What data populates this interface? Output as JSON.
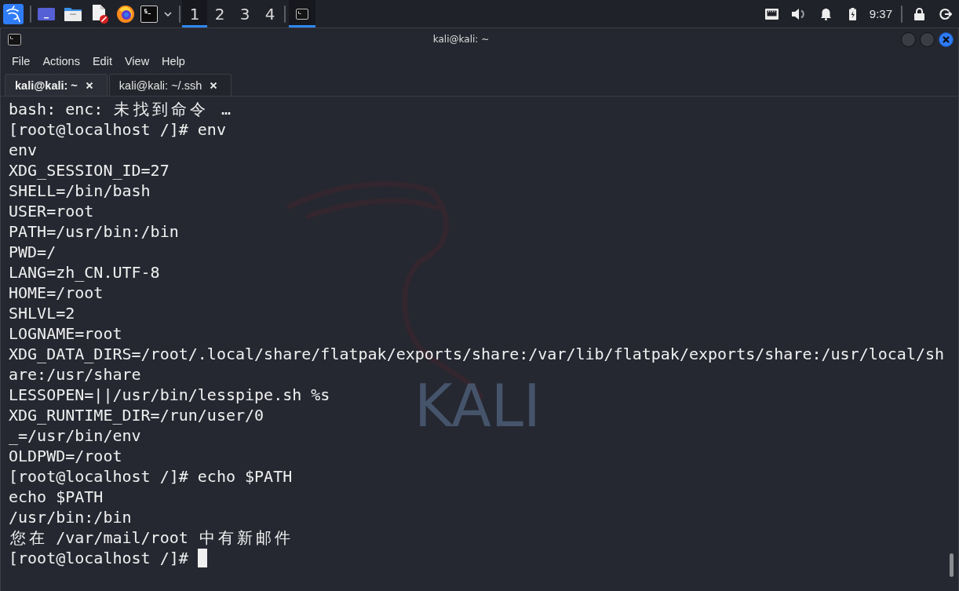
{
  "taskbar": {
    "workspaces": [
      {
        "label": "1",
        "selected": true
      },
      {
        "label": "2",
        "selected": false
      },
      {
        "label": "3",
        "selected": false
      },
      {
        "label": "4",
        "selected": false
      }
    ],
    "tasks": [
      {
        "selected": true
      }
    ],
    "clock": "9:37"
  },
  "window": {
    "title": "kali@kali: ~"
  },
  "menu": [
    "File",
    "Actions",
    "Edit",
    "View",
    "Help"
  ],
  "tabs": [
    {
      "label": "kali@kali: ~",
      "selected": true
    },
    {
      "label": "kali@kali: ~/.ssh",
      "selected": false
    }
  ],
  "terminal": {
    "lines": [
      "bash: enc: 未找到命令 …",
      "[root@localhost /]# env",
      "env",
      "XDG_SESSION_ID=27",
      "SHELL=/bin/bash",
      "USER=root",
      "PATH=/usr/bin:/bin",
      "PWD=/",
      "LANG=zh_CN.UTF-8",
      "HOME=/root",
      "SHLVL=2",
      "LOGNAME=root",
      "XDG_DATA_DIRS=/root/.local/share/flatpak/exports/share:/var/lib/flatpak/exports/share:/usr/local/sh",
      "are:/usr/share",
      "LESSOPEN=||/usr/bin/lesspipe.sh %s",
      "XDG_RUNTIME_DIR=/run/user/0",
      "_=/usr/bin/env",
      "OLDPWD=/root",
      "[root@localhost /]# echo $PATH",
      "echo $PATH",
      "/usr/bin:/bin",
      "您在 /var/mail/root 中有新邮件",
      "[root@localhost /]#"
    ],
    "cursor_visible": true
  },
  "wallpaper": {
    "logo_text": "KALI"
  }
}
